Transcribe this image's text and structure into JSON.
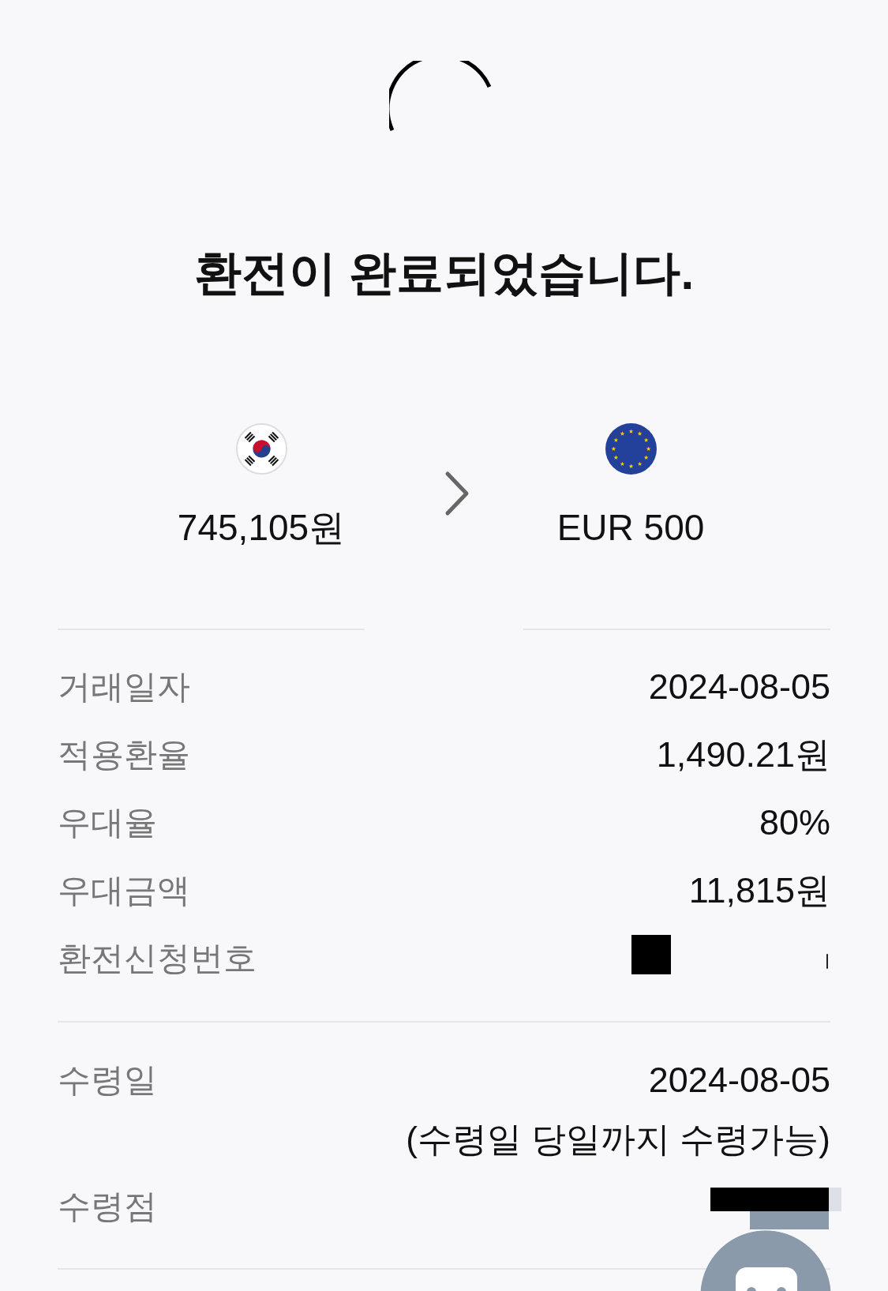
{
  "title": "환전이 완료되었습니다.",
  "exchange": [
    {
      "kind": "korea",
      "amount": "745,105원"
    },
    {
      "kind": "europe",
      "amount": "EUR 500"
    }
  ],
  "details": [
    {
      "label": "거래일자",
      "kind": "text",
      "value": "2024-08-05"
    },
    {
      "label": "적용환율",
      "kind": "text",
      "value": "1,490.21원"
    },
    {
      "label": "우대율",
      "kind": "text",
      "value": "80%"
    },
    {
      "label": "우대금액",
      "kind": "text",
      "value": "11,815원"
    },
    {
      "label": "환전신청번호",
      "kind": "redacted"
    }
  ],
  "pickup": [
    {
      "label": "수령일",
      "kind": "text",
      "value": "2024-08-05",
      "note": "(수령일 당일까지 수령가능)"
    },
    {
      "label": "수령점",
      "kind": "covered"
    }
  ]
}
